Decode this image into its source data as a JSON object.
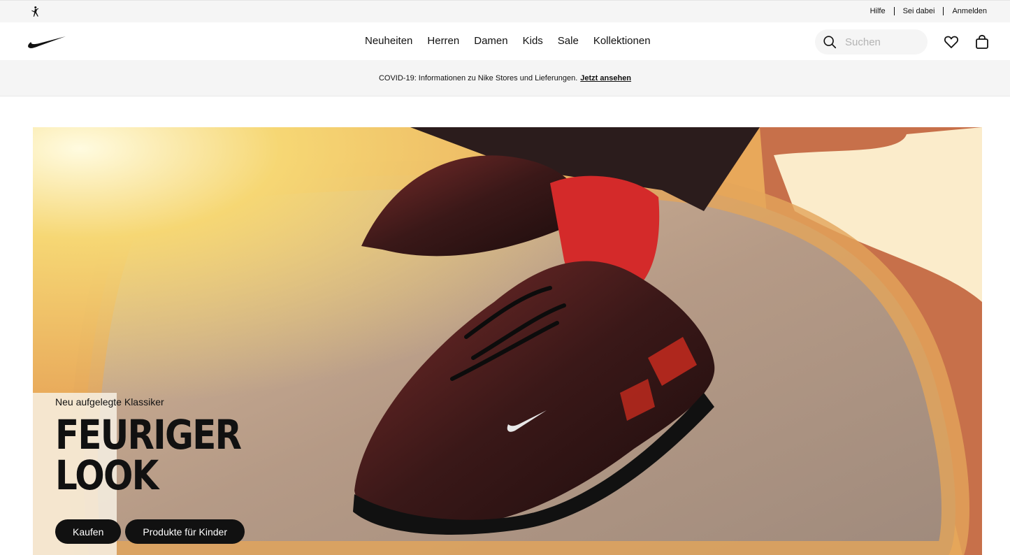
{
  "utility_bar": {
    "links": [
      "Hilfe",
      "Sei dabei",
      "Anmelden"
    ]
  },
  "main_nav": {
    "links": [
      "Neuheiten",
      "Herren",
      "Damen",
      "Kids",
      "Sale",
      "Kollektionen"
    ],
    "search": {
      "placeholder": "Suchen"
    }
  },
  "banner": {
    "text": "COVID-19: Informationen zu Nike Stores und Lieferungen.",
    "link": "Jetzt ansehen"
  },
  "hero": {
    "subtitle": "Neu aufgelegte Klassiker",
    "title_line1": "FEURIGER",
    "title_line2": "LOOK",
    "buttons": [
      "Kaufen",
      "Produkte für Kinder"
    ]
  },
  "icons": {
    "jordan": "jordan-logo-icon",
    "swoosh": "nike-swoosh-icon",
    "search": "search-icon",
    "favorites": "heart-icon",
    "bag": "bag-icon"
  },
  "colors": {
    "text": "#111111",
    "utility_bg": "#f5f5f5",
    "button_bg": "#111111",
    "button_text": "#ffffff",
    "search_placeholder": "#b3b3b3"
  }
}
